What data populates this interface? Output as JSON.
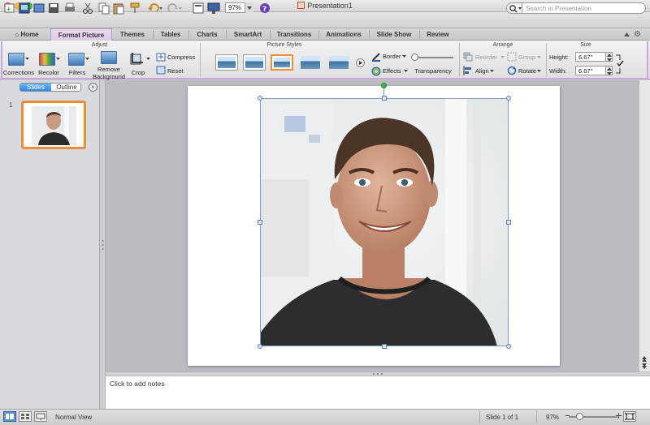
{
  "window": {
    "title": "Presentation1"
  },
  "toolbar": {
    "zoom_value": "97%",
    "search_placeholder": "Search in Presentation"
  },
  "tabs": [
    {
      "label": "Home"
    },
    {
      "label": "Format Picture"
    },
    {
      "label": "Themes"
    },
    {
      "label": "Tables"
    },
    {
      "label": "Charts"
    },
    {
      "label": "SmartArt"
    },
    {
      "label": "Transitions"
    },
    {
      "label": "Animations"
    },
    {
      "label": "Slide Show"
    },
    {
      "label": "Review"
    }
  ],
  "ribbon": {
    "groups": {
      "adjust": "Adjust",
      "picture_styles": "Picture Styles",
      "arrange": "Arrange",
      "size": "Size"
    },
    "adjust": {
      "corrections": "Corrections",
      "recolor": "Recolor",
      "filters": "Filters",
      "remove_bg_1": "Remove",
      "remove_bg_2": "Background",
      "crop": "Crop",
      "compress": "Compress",
      "reset": "Reset"
    },
    "styles": {
      "border": "Border",
      "effects": "Effects",
      "transparency": "Transparency"
    },
    "arrange": {
      "reorder": "Reorder",
      "group": "Group",
      "align": "Align",
      "rotate": "Rotate"
    },
    "size": {
      "height_label": "Height:",
      "height_value": "6.67\"",
      "width_label": "Width:",
      "width_value": "6.67\""
    }
  },
  "left_panel": {
    "slides_tab": "Slides",
    "outline_tab": "Outline",
    "slide_number": "1"
  },
  "notes": {
    "placeholder": "Click to add notes"
  },
  "status": {
    "view": "Normal View",
    "slide_of": "Slide 1 of 1",
    "zoom": "97%"
  },
  "colors": {
    "accent_purple": "#c6a6dc",
    "selection_orange": "#f08c37",
    "segment_blue": "#1e7ee8",
    "rotation_handle": "#46b54a"
  }
}
